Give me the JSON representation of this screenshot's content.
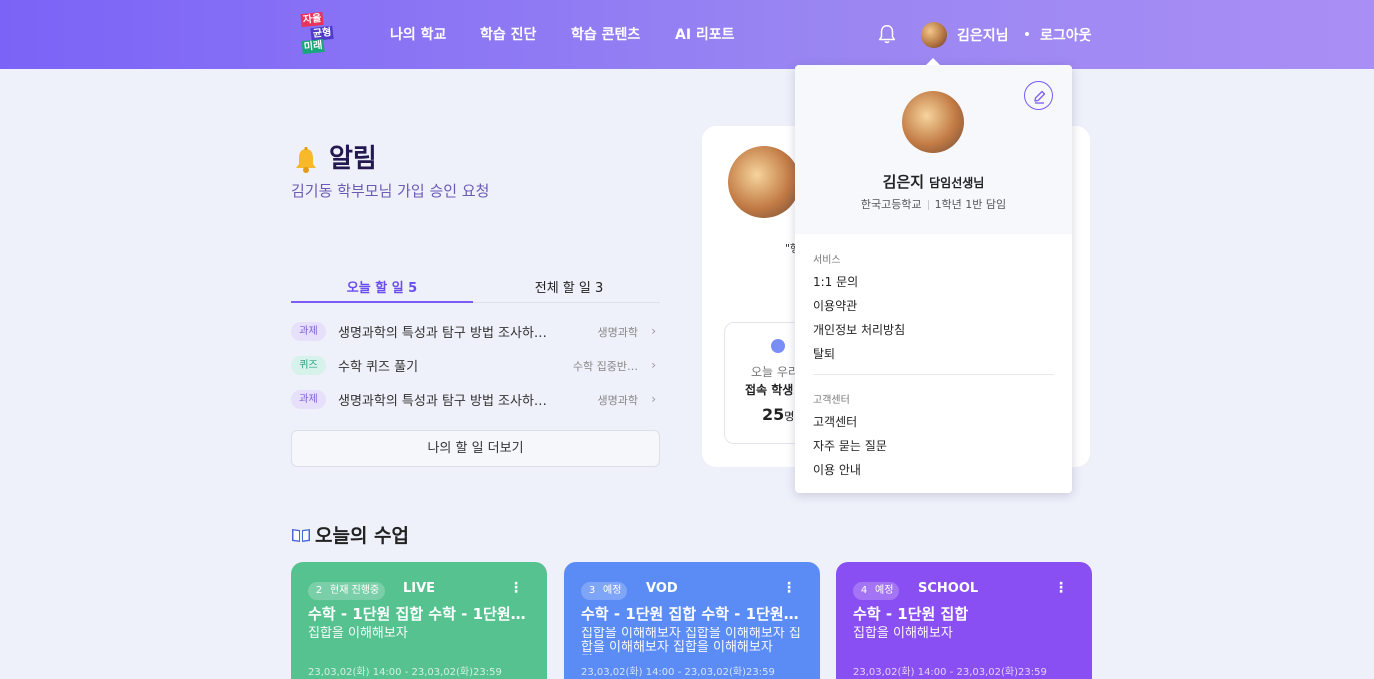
{
  "header": {
    "logo": [
      "자율",
      "균형",
      "미래"
    ],
    "nav": [
      "나의 학교",
      "학습 진단",
      "학습 콘텐츠",
      "AI 리포트"
    ],
    "user_name": "김은지님",
    "logout": "로그아웃"
  },
  "notice": {
    "title": "알림",
    "message": "김기동 학부모님 가입 승인 요청"
  },
  "todo": {
    "tabs": [
      "오늘 할 일 5",
      "전체 할 일 3"
    ],
    "items": [
      {
        "badge": "과제",
        "title": "생명과학의 특성과 탐구 방법 조사하…",
        "subject": "생명과학"
      },
      {
        "badge": "퀴즈",
        "title": "수학 퀴즈 풀기",
        "subject": "수학 집중반…"
      },
      {
        "badge": "과제",
        "title": "생명과학의 특성과 탐구 방법 조사하…",
        "subject": "생명과학"
      }
    ],
    "more": "나의 할 일 더보기"
  },
  "profile_card": {
    "quote": "\"행",
    "stat_line1": "오늘 우리",
    "stat_line2": "접속 학생",
    "stat_num": "25",
    "stat_unit": "명"
  },
  "dropdown": {
    "name": "김은지",
    "role": "담임선생님",
    "school": "한국고등학교",
    "class": "1학년 1반 담임",
    "service_label": "서비스",
    "service_items": [
      "1:1 문의",
      "이용약관",
      "개인정보 처리방침",
      "탈퇴"
    ],
    "support_label": "고객센터",
    "support_items": [
      "고객센터",
      "자주 묻는 질문",
      "이용 안내"
    ]
  },
  "classes": {
    "title": "오늘의 수업",
    "cards": [
      {
        "num": "2",
        "status": "현재 진행중",
        "type": "LIVE",
        "title": "수학 - 1단원 집합 수학 - 1단원 집…",
        "desc": "집합을 이해해보자",
        "date": "23,03,02(화) 14:00 - 23,03,02(화)23:59"
      },
      {
        "num": "3",
        "status": "예정",
        "type": "VOD",
        "title": "수학 - 1단원 집합 수학 - 1단원 집…",
        "desc": "집합을 이해해보자 집합을 이해해보자 집합을 이해해보자 집합을 이해해보자 집…",
        "date": "23,03,02(화) 14:00 - 23,03,02(화)23:59"
      },
      {
        "num": "4",
        "status": "예정",
        "type": "SCHOOL",
        "title": "수학 - 1단원 집합",
        "desc": "집합을 이해해보자",
        "date": "23,03,02(화) 14:00 - 23,03,02(화)23:59"
      }
    ]
  }
}
